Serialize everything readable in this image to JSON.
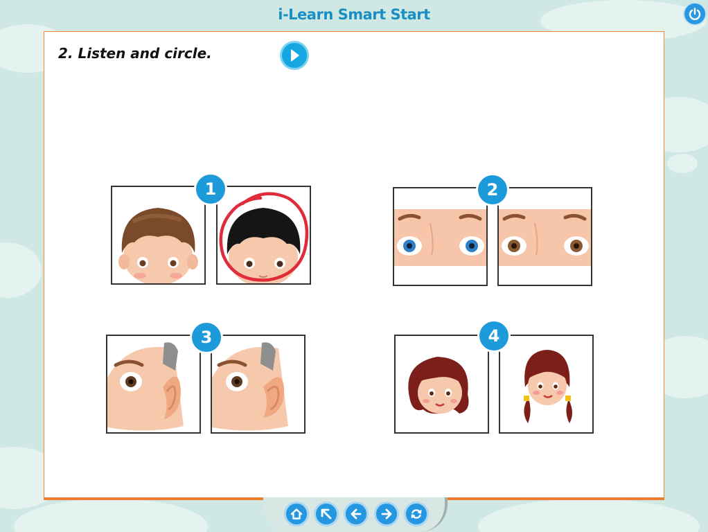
{
  "app": {
    "title": "i-Learn Smart Start"
  },
  "exercise": {
    "instruction": "2. Listen and circle."
  },
  "items": [
    {
      "number": "1",
      "selected_option": 2
    },
    {
      "number": "2",
      "selected_option": null
    },
    {
      "number": "3",
      "selected_option": null
    },
    {
      "number": "4",
      "selected_option": null
    }
  ],
  "colors": {
    "accent": "#1d9ad9",
    "panel_border": "#ef7d31",
    "selection_circle": "#e02b3a",
    "background": "#cfe8e3"
  },
  "icons": {
    "power": "power-icon",
    "play": "play-icon",
    "home": "home-icon",
    "pointer": "arrow-up-left-icon",
    "back": "arrow-left-icon",
    "forward": "arrow-right-icon",
    "reload": "reload-icon"
  }
}
